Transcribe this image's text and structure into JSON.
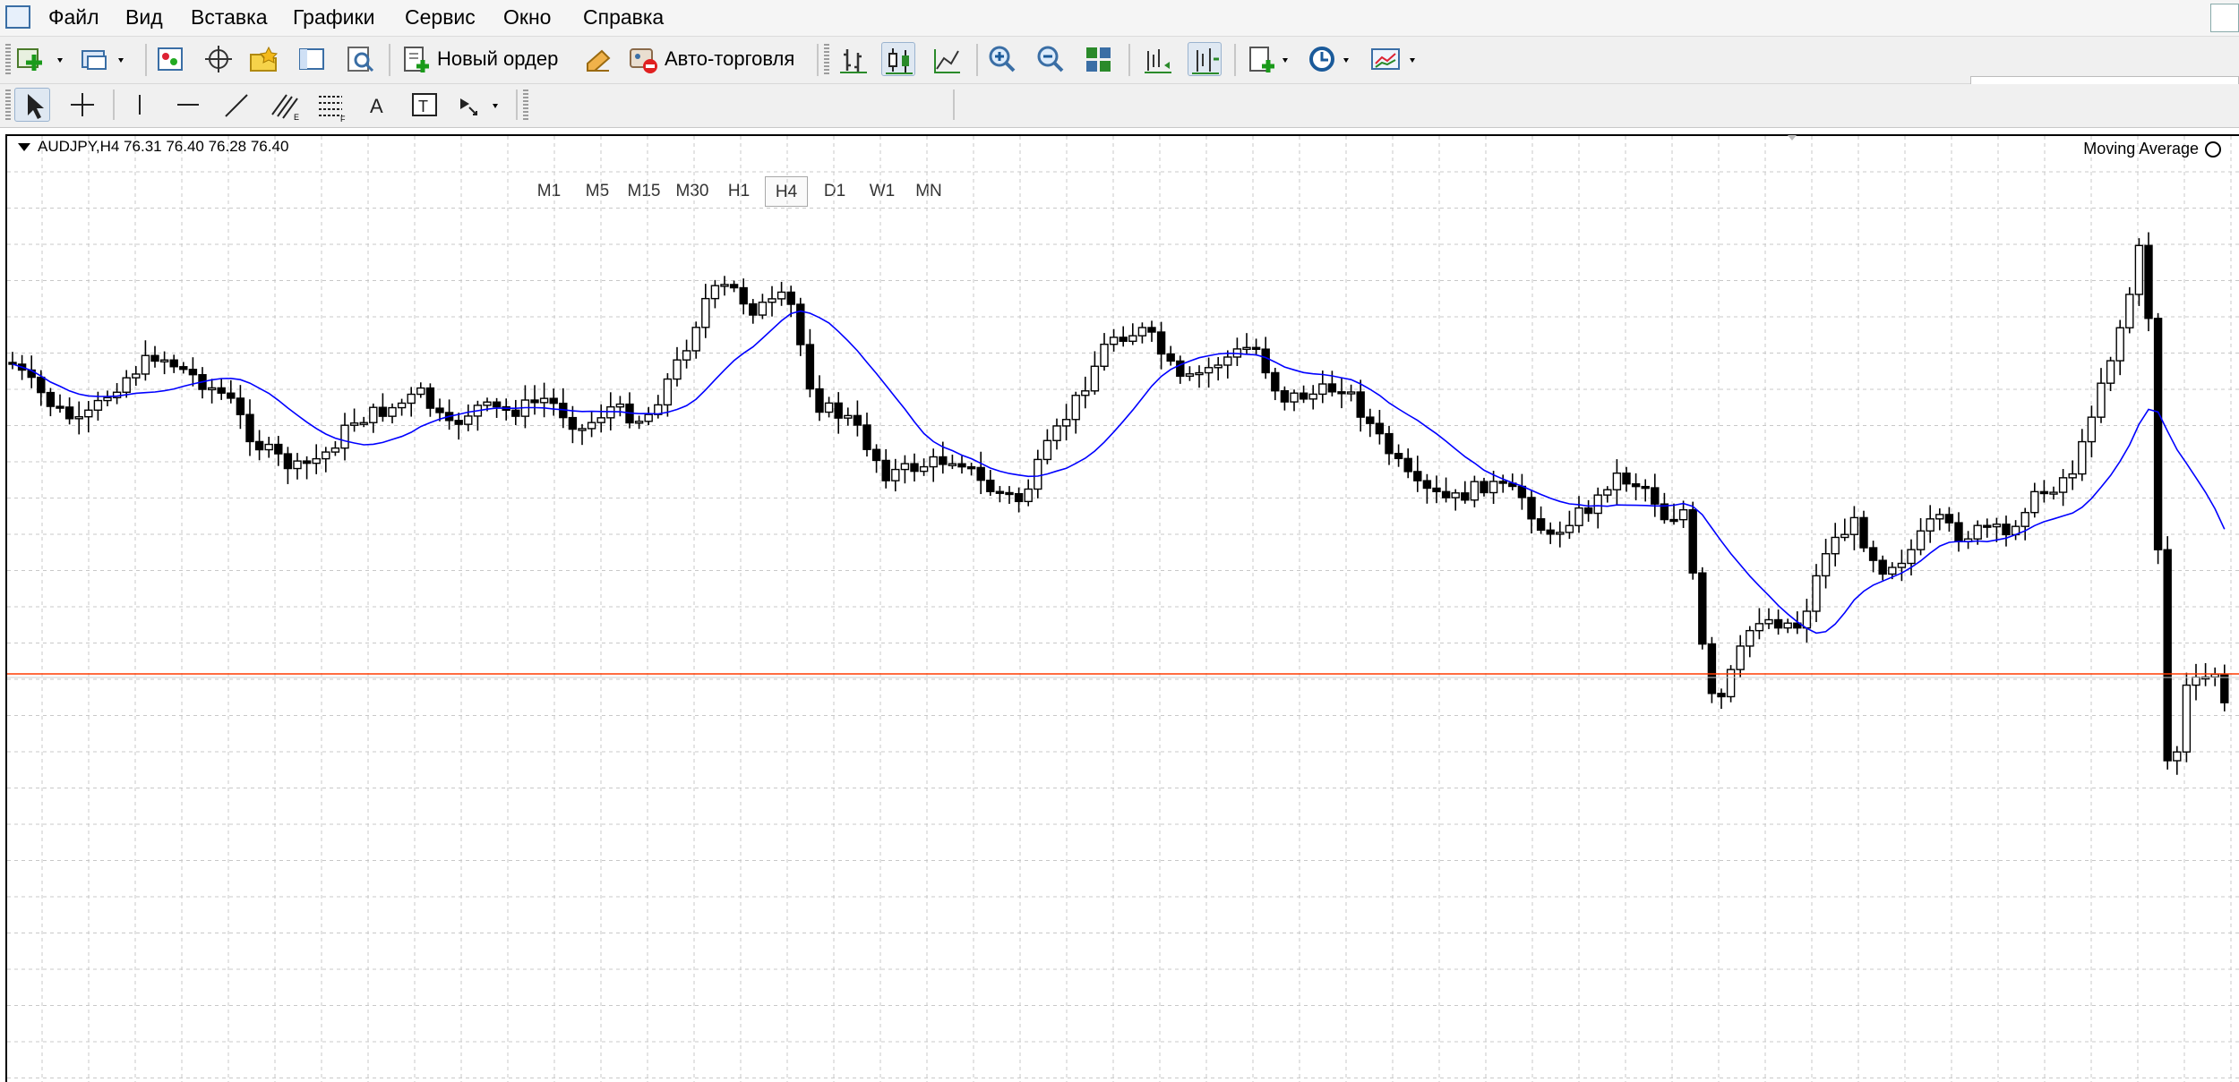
{
  "menu": {
    "items": [
      "Файл",
      "Вид",
      "Вставка",
      "Графики",
      "Сервис",
      "Окно",
      "Справка"
    ]
  },
  "toolbar": {
    "new_order_label": "Новый ордер",
    "autotrading_label": "Авто-торговля"
  },
  "timeframes": [
    "M1",
    "M5",
    "M15",
    "M30",
    "H1",
    "H4",
    "D1",
    "W1",
    "MN"
  ],
  "active_timeframe": "H4",
  "chart": {
    "symbol_info": "AUDJPY,H4  76.31 76.40 76.28 76.40",
    "indicator_label": "Moving Average",
    "price_line_color": "#ff3b00",
    "ma_color": "#0000ff",
    "grid_color": "#c8c8c8"
  }
}
